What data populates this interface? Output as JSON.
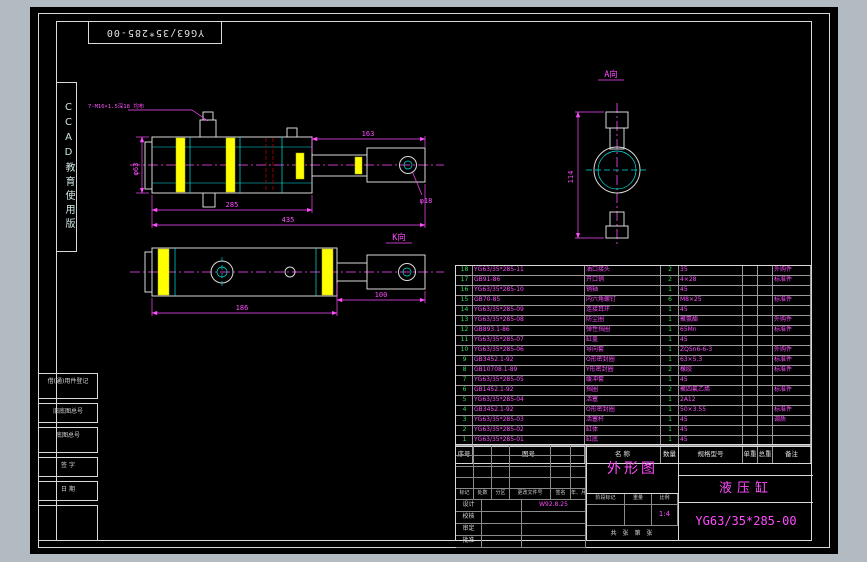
{
  "border": {
    "top_code": "YG63/35*285-00",
    "watermark": "CCAD教育使用版"
  },
  "dims": {
    "leader_note": "7-M16×1.5深18 均布",
    "rod_len": "163",
    "stroke": "285",
    "total": "435",
    "bore": "φ63",
    "pin_hole": "φ18",
    "k_len": "100",
    "k_body": "186",
    "a_height": "114",
    "a_label": "A向",
    "k_label": "K向"
  },
  "margin_blocks": [
    "借(通)用件登记",
    "旧底图总号",
    "底图总号",
    "签 字",
    "日 期",
    ""
  ],
  "bom": {
    "headers": [
      "序号",
      "图号",
      "名 称",
      "数量",
      "规格型号",
      "单重",
      "总重",
      "备注"
    ],
    "rows": [
      {
        "no": "18",
        "code": "YG63/35*285-11",
        "name": "油口接头",
        "qty": "2",
        "spec": "35",
        "remark": "外购件"
      },
      {
        "no": "17",
        "code": "GB91-86",
        "name": "开口销",
        "qty": "2",
        "spec": "4×28",
        "remark": "标准件"
      },
      {
        "no": "16",
        "code": "YG63/35*285-10",
        "name": "销轴",
        "qty": "1",
        "spec": "45",
        "remark": ""
      },
      {
        "no": "15",
        "code": "GB70-85",
        "name": "内六角螺钉",
        "qty": "6",
        "spec": "M8×25",
        "remark": "标准件"
      },
      {
        "no": "14",
        "code": "YG63/35*285-09",
        "name": "连接耳环",
        "qty": "1",
        "spec": "45",
        "remark": ""
      },
      {
        "no": "13",
        "code": "YG63/35*285-08",
        "name": "防尘圈",
        "qty": "1",
        "spec": "聚氨酯",
        "remark": "外购件"
      },
      {
        "no": "12",
        "code": "GB893.1-86",
        "name": "弹性挡圈",
        "qty": "1",
        "spec": "65Mn",
        "remark": "标准件"
      },
      {
        "no": "11",
        "code": "YG63/35*285-07",
        "name": "缸盖",
        "qty": "1",
        "spec": "45",
        "remark": ""
      },
      {
        "no": "10",
        "code": "YG63/35*285-06",
        "name": "导向套",
        "qty": "1",
        "spec": "ZQSn6-6-3",
        "remark": "外购件"
      },
      {
        "no": "9",
        "code": "GB3452.1-92",
        "name": "O形密封圈",
        "qty": "1",
        "spec": "63×5.3",
        "remark": "标准件"
      },
      {
        "no": "8",
        "code": "GB10708.1-89",
        "name": "Y形密封圈",
        "qty": "2",
        "spec": "橡胶",
        "remark": "标准件"
      },
      {
        "no": "7",
        "code": "YG63/35*285-05",
        "name": "缓冲套",
        "qty": "1",
        "spec": "45",
        "remark": ""
      },
      {
        "no": "6",
        "code": "GB1452.1-92",
        "name": "挡圈",
        "qty": "2",
        "spec": "聚四氟乙烯",
        "remark": "标准件"
      },
      {
        "no": "5",
        "code": "YG63/35*285-04",
        "name": "活塞",
        "qty": "1",
        "spec": "2A12",
        "remark": ""
      },
      {
        "no": "4",
        "code": "GB3452.1-92",
        "name": "O形密封圈",
        "qty": "1",
        "spec": "50×3.55",
        "remark": "标准件"
      },
      {
        "no": "3",
        "code": "YG63/35*285-03",
        "name": "活塞杆",
        "qty": "1",
        "spec": "45",
        "remark": "调质"
      },
      {
        "no": "2",
        "code": "YG63/35*285-02",
        "name": "缸体",
        "qty": "1",
        "spec": "45",
        "remark": ""
      },
      {
        "no": "1",
        "code": "YG63/35*285-01",
        "name": "缸底",
        "qty": "1",
        "spec": "45",
        "remark": ""
      }
    ]
  },
  "title_block": {
    "drawing_title": "外形图",
    "product_name": "液压缸",
    "drawing_no": "YG63/35*285-00",
    "sig_header": [
      "标记",
      "处数",
      "分区",
      "更改文件号",
      "签名",
      "年、月、日"
    ],
    "sig_rows": [
      {
        "label": "设计",
        "date": "W92.8.25"
      },
      {
        "label": "校核",
        "date": ""
      },
      {
        "label": "审定",
        "date": ""
      },
      {
        "label": "批准",
        "date": ""
      }
    ],
    "stage_header": [
      "阶段标记",
      "重量",
      "比例"
    ],
    "scale": "1:4",
    "sheet_note": "共 张 第 张"
  }
}
